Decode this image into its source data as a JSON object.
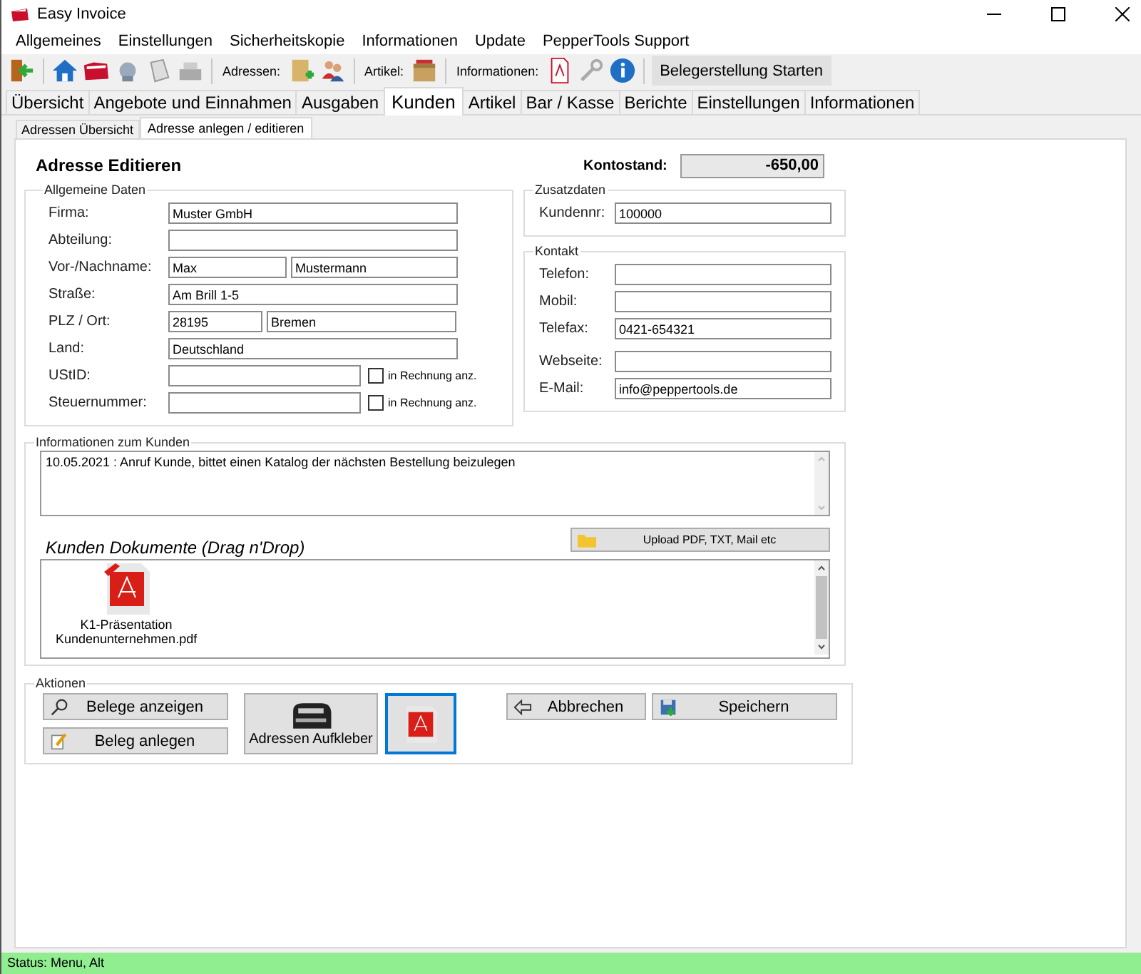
{
  "window": {
    "title": "Easy Invoice"
  },
  "menu": [
    "Allgemeines",
    "Einstellungen",
    "Sicherheitskopie",
    "Informationen",
    "Update",
    "PepperTools Support"
  ],
  "toolbar": {
    "addresses_label": "Adressen:",
    "articles_label": "Artikel:",
    "info_label": "Informationen:",
    "start_button": "Belegerstellung Starten"
  },
  "tabs": [
    {
      "label": "Übersicht",
      "selected": false
    },
    {
      "label": "Angebote und Einnahmen",
      "selected": false
    },
    {
      "label": "Ausgaben",
      "selected": false
    },
    {
      "label": "Kunden",
      "selected": true
    },
    {
      "label": "Artikel",
      "selected": false
    },
    {
      "label": "Bar / Kasse",
      "selected": false
    },
    {
      "label": "Berichte",
      "selected": false
    },
    {
      "label": "Einstellungen",
      "selected": false
    },
    {
      "label": "Informationen",
      "selected": false
    }
  ],
  "subtabs": [
    {
      "label": "Adressen Übersicht",
      "selected": false
    },
    {
      "label": "Adresse anlegen / editieren",
      "selected": true
    }
  ],
  "heading": "Adresse Editieren",
  "balance": {
    "label": "Kontostand:",
    "value": "-650,00"
  },
  "general": {
    "title": "Allgemeine Daten",
    "rows": [
      {
        "kind": "single",
        "label": "Firma:",
        "fields": [
          "Muster GmbH"
        ]
      },
      {
        "kind": "single",
        "label": "Abteilung:"
      },
      {
        "kind": "name",
        "label": "Vor-/Nachname:",
        "fields": [
          "Max",
          "Mustermann"
        ]
      },
      {
        "kind": "single",
        "label": "Straße:",
        "fields": [
          "Am Brill 1-5"
        ]
      },
      {
        "kind": "zip",
        "label": "PLZ / Ort:",
        "fields": [
          "28195",
          "Bremen"
        ]
      },
      {
        "kind": "single",
        "label": "Land:",
        "fields": [
          "Deutschland"
        ]
      },
      {
        "kind": "check",
        "label": "UStID:",
        "check_label": "in Rechnung anz.",
        "checked": false
      },
      {
        "kind": "check",
        "label": "Steuernummer:",
        "check_label": "in Rechnung anz.",
        "checked": false
      }
    ]
  },
  "extra": {
    "title": "Zusatzdaten",
    "label": "Kundennr:",
    "value": "100000"
  },
  "contact": {
    "title": "Kontakt",
    "rows": [
      {
        "label": "Telefon:"
      },
      {
        "label": "Mobil:"
      },
      {
        "label": "Telefax:",
        "value": "0421-654321"
      },
      {
        "label": "Webseite:"
      },
      {
        "label": "E-Mail:",
        "value": "info@peppertools.de"
      }
    ]
  },
  "info": {
    "title": "Informationen zum Kunden",
    "notes": "10.05.2021 : Anruf Kunde, bittet einen Katalog der nächsten Bestellung beizulegen",
    "documents_title": "Kunden Dokumente (Drag n'Drop)",
    "upload_button": "Upload PDF, TXT, Mail etc",
    "documents": [
      {
        "name_lines": [
          "K1-Präsentation",
          "Kundenunternehmen.pdf"
        ]
      }
    ]
  },
  "actions": {
    "title": "Aktionen",
    "show_button": "Belege anzeigen",
    "create_button": "Beleg anlegen",
    "label_button": "Adressen Aufkleber",
    "cancel_button": "Abbrechen",
    "save_button": "Speichern"
  },
  "status_bar": "Status:  Menu, Alt"
}
